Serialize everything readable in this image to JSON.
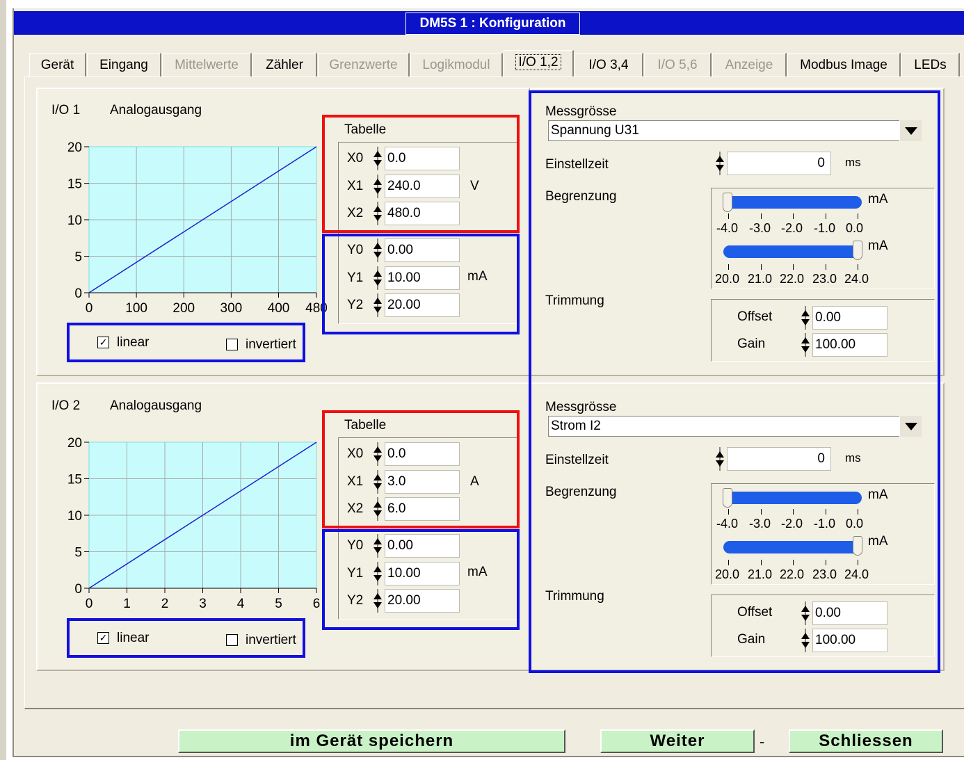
{
  "window": {
    "title": "DM5S 1 : Konfiguration"
  },
  "tabs": [
    {
      "label": "Gerät",
      "enabled": true
    },
    {
      "label": "Eingang",
      "enabled": true
    },
    {
      "label": "Mittelwerte",
      "enabled": false
    },
    {
      "label": "Zähler",
      "enabled": true
    },
    {
      "label": "Grenzwerte",
      "enabled": false
    },
    {
      "label": "Logikmodul",
      "enabled": false
    },
    {
      "label": "I/O 1,2",
      "enabled": true,
      "active": true
    },
    {
      "label": "I/O 3,4",
      "enabled": true
    },
    {
      "label": "I/O 5,6",
      "enabled": false
    },
    {
      "label": "Anzeige",
      "enabled": false
    },
    {
      "label": "Modbus Image",
      "enabled": true
    },
    {
      "label": "LEDs",
      "enabled": true
    }
  ],
  "io": [
    {
      "name": "I/O 1",
      "type": "Analogausgang",
      "table": {
        "title": "Tabelle",
        "x0_label": "X0",
        "x0": "0.0",
        "x1_label": "X1",
        "x1": "240.0",
        "x2_label": "X2",
        "x2": "480.0",
        "x_unit": "V",
        "y0_label": "Y0",
        "y0": "0.00",
        "y1_label": "Y1",
        "y1": "10.00",
        "y2_label": "Y2",
        "y2": "20.00",
        "y_unit": "mA"
      },
      "options": {
        "linear_label": "linear",
        "linear_checked": "✓",
        "invert_label": "invertiert",
        "invert_checked": ""
      },
      "settings": {
        "messgroesse_label": "Messgrösse",
        "messgroesse": "Spannung U31",
        "einstellzeit_label": "Einstellzeit",
        "einstellzeit": "0",
        "einstellzeit_unit": "ms",
        "begrenzung_label": "Begrenzung",
        "lower_unit": "mA",
        "lower_ticks": [
          "-4.0",
          "-3.0",
          "-2.0",
          "-1.0",
          "0.0"
        ],
        "upper_unit": "mA",
        "upper_ticks": [
          "20.0",
          "21.0",
          "22.0",
          "23.0",
          "24.0"
        ],
        "trimmung_label": "Trimmung",
        "offset_label": "Offset",
        "offset": "0.00",
        "gain_label": "Gain",
        "gain": "100.00"
      }
    },
    {
      "name": "I/O 2",
      "type": "Analogausgang",
      "table": {
        "title": "Tabelle",
        "x0_label": "X0",
        "x0": "0.0",
        "x1_label": "X1",
        "x1": "3.0",
        "x2_label": "X2",
        "x2": "6.0",
        "x_unit": "A",
        "y0_label": "Y0",
        "y0": "0.00",
        "y1_label": "Y1",
        "y1": "10.00",
        "y2_label": "Y2",
        "y2": "20.00",
        "y_unit": "mA"
      },
      "options": {
        "linear_label": "linear",
        "linear_checked": "✓",
        "invert_label": "invertiert",
        "invert_checked": ""
      },
      "settings": {
        "messgroesse_label": "Messgrösse",
        "messgroesse": "Strom I2",
        "einstellzeit_label": "Einstellzeit",
        "einstellzeit": "0",
        "einstellzeit_unit": "ms",
        "begrenzung_label": "Begrenzung",
        "lower_unit": "mA",
        "lower_ticks": [
          "-4.0",
          "-3.0",
          "-2.0",
          "-1.0",
          "0.0"
        ],
        "upper_unit": "mA",
        "upper_ticks": [
          "20.0",
          "21.0",
          "22.0",
          "23.0",
          "24.0"
        ],
        "trimmung_label": "Trimmung",
        "offset_label": "Offset",
        "offset": "0.00",
        "gain_label": "Gain",
        "gain": "100.00"
      }
    }
  ],
  "buttons": {
    "save": "im Gerät speichern",
    "next": "Weiter",
    "separator": "-",
    "close": "Schliessen"
  },
  "colors": {
    "title_bar": "#0b12c8",
    "plot_bg": "#c8fcfc",
    "plot_grid": "#a8a8a8",
    "plot_line": "#2020d0",
    "slider": "#1d5de8",
    "highlight_red": "#ee1111",
    "highlight_blue": "#1010e0",
    "button_bg": "#c9f2c6"
  },
  "chart_data": [
    {
      "type": "line",
      "x": [
        0,
        480
      ],
      "y": [
        0,
        20
      ],
      "xlim": [
        0,
        480
      ],
      "ylim": [
        0,
        20
      ],
      "xticks": [
        "0",
        "100",
        "200",
        "300",
        "400",
        "480"
      ],
      "yticks": [
        "0",
        "5",
        "10",
        "15",
        "20"
      ],
      "grid": true
    },
    {
      "type": "line",
      "x": [
        0,
        6
      ],
      "y": [
        0,
        20
      ],
      "xlim": [
        0,
        6
      ],
      "ylim": [
        0,
        20
      ],
      "xticks": [
        "0",
        "1",
        "2",
        "3",
        "4",
        "5",
        "6"
      ],
      "yticks": [
        "0",
        "5",
        "10",
        "15",
        "20"
      ],
      "grid": true
    }
  ]
}
